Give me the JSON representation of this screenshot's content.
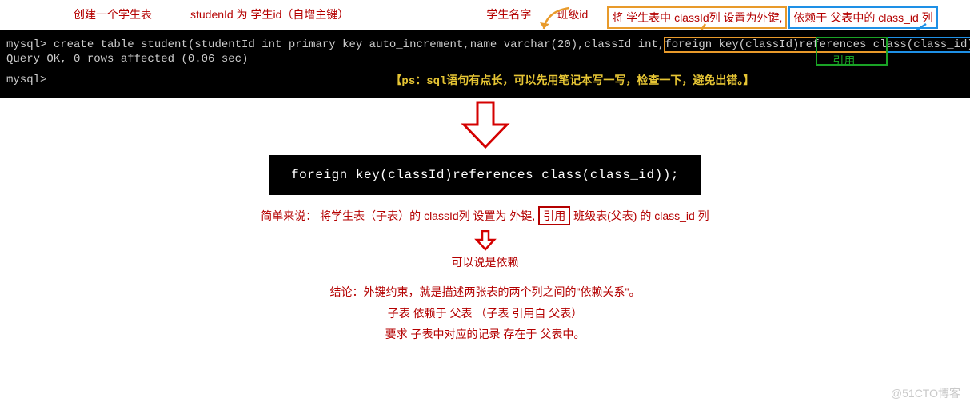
{
  "labels": {
    "create_table": "创建一个学生表",
    "student_id": "studenId 为 学生id（自增主键）",
    "student_name": "学生名字",
    "class_id": "班级id",
    "fk_note": "将 学生表中 classId列 设置为外键,",
    "depend_note": "依赖于 父表中的 class_id 列"
  },
  "terminal": {
    "prompt1": "mysql> ",
    "cmd_pre": "create table  student(studentId int primary key auto_increment,name varchar(20),classId int,",
    "cmd_fk": "foreign key(classId)references class(class_id));",
    "result": "Query OK, 0 rows affected (0.06 sec)",
    "prompt2": "mysql>",
    "ps_note": "【ps：sql语句有点长，可以先用笔记本写一写，检查一下，避免出错。】",
    "references_label": "引用"
  },
  "mid": {
    "code": "foreign key(classId)references class(class_id));",
    "explain_pre": "简单来说： 将学生表（子表）的 classId列 设置为 外键,",
    "explain_box": "引用",
    "explain_post": " 班级表(父表) 的 class_id 列",
    "depend": "可以说是依赖"
  },
  "conclusion": {
    "line1": "结论：外键约束，就是描述两张表的两个列之间的\"依赖关系\"。",
    "line2": "子表 依赖于 父表 （子表 引用自 父表）",
    "line3": "要求 子表中对应的记录 存在于 父表中。"
  },
  "watermark": "@51CTO博客"
}
